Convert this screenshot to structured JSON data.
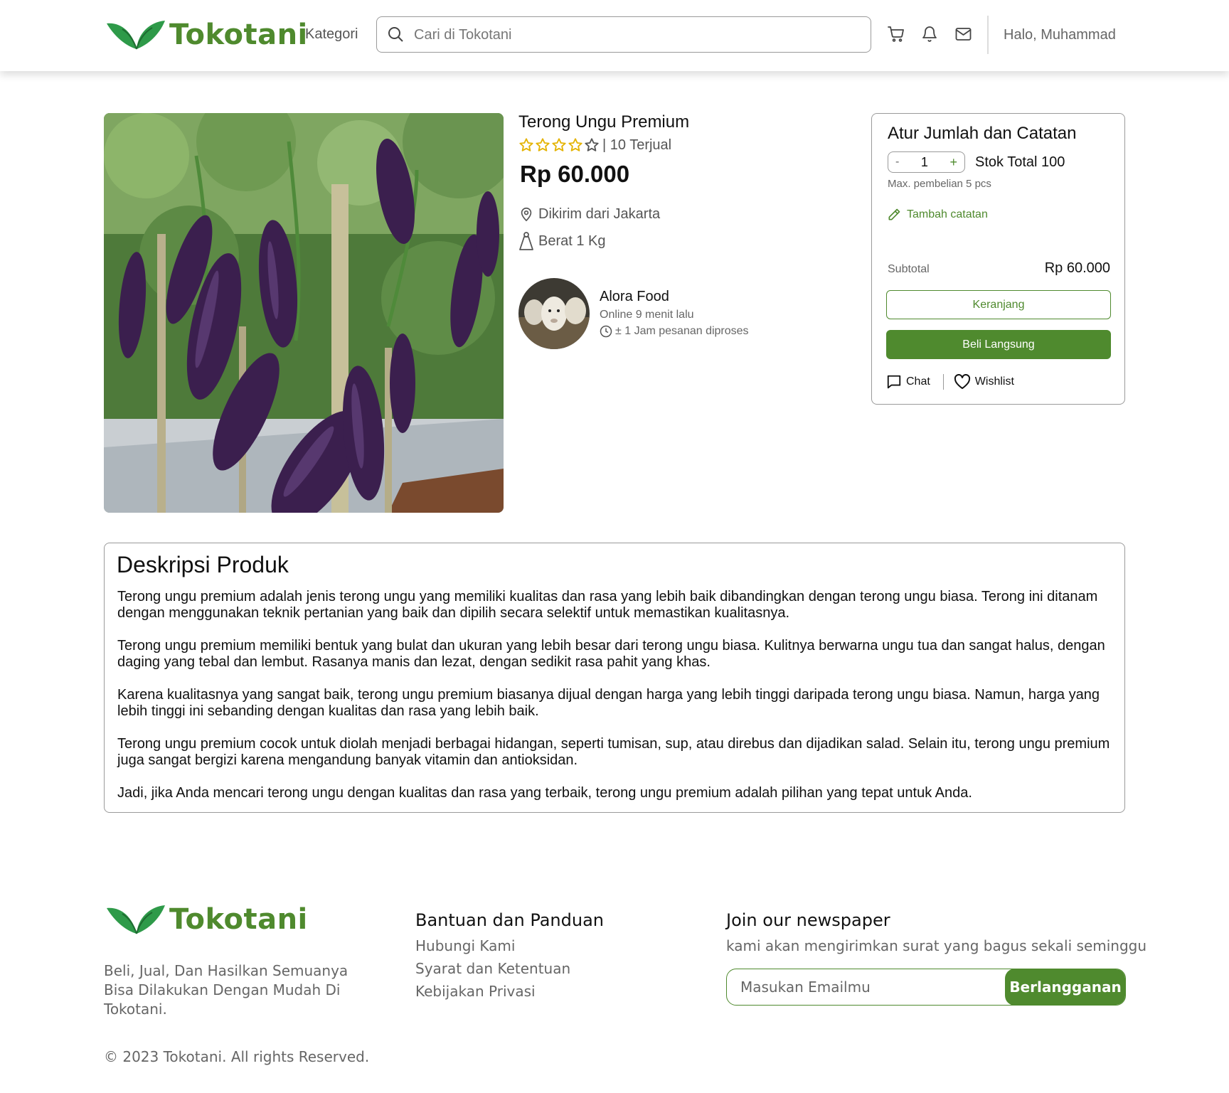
{
  "brand": {
    "name": "Tokotani",
    "color": "#4f8a2e"
  },
  "header": {
    "kategori": "Kategori",
    "search_placeholder": "Cari di Tokotani",
    "greeting": "Halo, Muhammad",
    "icons": [
      "cart-icon",
      "bell-icon",
      "mail-icon"
    ]
  },
  "product": {
    "title": "Terong Ungu Premium",
    "rating_stars": 5,
    "sold": "| 10 Terjual",
    "price": "Rp 60.000",
    "shipped_from": "Dikirim dari Jakarta",
    "weight": "Berat 1 Kg"
  },
  "seller": {
    "name": "Alora Food",
    "online": "Online 9 menit lalu",
    "processing": "± 1 Jam pesanan diproses"
  },
  "purchase": {
    "title": "Atur Jumlah dan Catatan",
    "minus": "-",
    "quantity": "1",
    "plus": "+",
    "stock": "Stok Total 100",
    "max_purchase": "Max. pembelian 5 pcs",
    "add_note": "Tambah catatan",
    "subtotal_label": "Subtotal",
    "subtotal_value": "Rp 60.000",
    "cart_button": "Keranjang",
    "buy_button": "Beli Langsung",
    "chat": "Chat",
    "wishlist": "Wishlist"
  },
  "description": {
    "title": "Deskripsi Produk",
    "paragraphs": [
      "Terong ungu premium adalah jenis terong ungu yang memiliki kualitas dan rasa yang lebih baik dibandingkan dengan terong ungu biasa. Terong ini ditanam dengan menggunakan teknik pertanian yang baik dan dipilih secara selektif untuk memastikan kualitasnya.",
      "Terong ungu premium memiliki bentuk yang bulat dan ukuran yang lebih besar dari terong ungu biasa. Kulitnya berwarna ungu tua dan sangat halus, dengan daging yang tebal dan lembut. Rasanya manis dan lezat, dengan sedikit rasa pahit yang khas.",
      "Karena kualitasnya yang sangat baik, terong ungu premium biasanya dijual dengan harga yang lebih tinggi daripada terong ungu biasa. Namun, harga yang lebih tinggi ini sebanding dengan kualitas dan rasa yang lebih baik.",
      "Terong ungu premium cocok untuk diolah menjadi berbagai hidangan, seperti tumisan, sup, atau direbus dan dijadikan salad. Selain itu, terong ungu premium juga sangat bergizi karena mengandung banyak vitamin dan antioksidan.",
      "Jadi, jika Anda mencari terong ungu dengan kualitas dan rasa yang terbaik, terong ungu premium adalah pilihan yang tepat untuk Anda."
    ]
  },
  "footer": {
    "tagline": "Beli, Jual, Dan Hasilkan Semuanya Bisa Dilakukan Dengan Mudah Di Tokotani.",
    "help_title": "Bantuan dan Panduan",
    "help_links": [
      "Hubungi Kami",
      "Syarat dan Ketentuan",
      "Kebijakan Privasi"
    ],
    "newsletter_title": "Join our newspaper",
    "newsletter_sub": "kami akan mengirimkan surat yang bagus sekali seminggu",
    "email_placeholder": "Masukan Emailmu",
    "subscribe_button": "Berlangganan",
    "copyright": "© 2023 Tokotani. All rights Reserved."
  }
}
